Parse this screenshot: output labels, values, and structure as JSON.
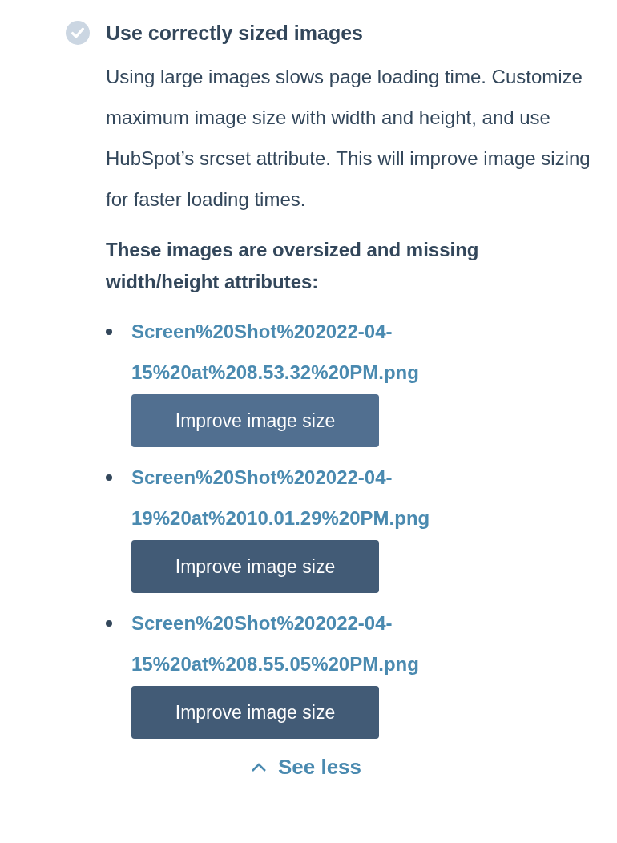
{
  "check": {
    "title": "Use correctly sized images",
    "description": "Using large images slows page loading time. Customize maximum image size with width and height, and use HubSpot’s srcset attribute. This will improve image sizing for faster loading times.",
    "subheading": "These images are oversized and missing width/height attributes:",
    "images": [
      {
        "file": "Screen%20Shot%202022-04-15%20at%208.53.32%20PM.png",
        "button": "Improve image size",
        "hovered": true
      },
      {
        "file": "Screen%20Shot%202022-04-19%20at%2010.01.29%20PM.png",
        "button": "Improve image size",
        "hovered": false
      },
      {
        "file": "Screen%20Shot%202022-04-15%20at%208.55.05%20PM.png",
        "button": "Improve image size",
        "hovered": false
      }
    ],
    "toggle": "See less"
  }
}
